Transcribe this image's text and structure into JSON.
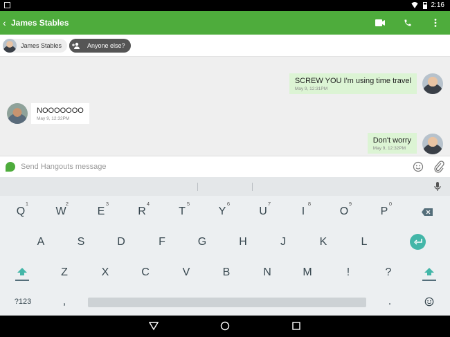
{
  "status": {
    "time": "2:16"
  },
  "app_bar": {
    "title": "James Stables",
    "icons": [
      "back-icon",
      "video-call-icon",
      "phone-icon",
      "more-icon"
    ]
  },
  "participants": {
    "chips": [
      {
        "label": "James Stables"
      },
      {
        "label": "Anyone else?"
      }
    ]
  },
  "messages": [
    {
      "direction": "out",
      "text": "SCREW YOU I'm using time travel",
      "time": "May 9, 12:31PM"
    },
    {
      "direction": "in",
      "text": "NOOOOOOO",
      "time": "May 9, 12:32PM"
    },
    {
      "direction": "out",
      "text": "Don't worry",
      "time": "May 9, 12:32PM"
    }
  ],
  "composer": {
    "placeholder": "Send Hangouts message"
  },
  "keyboard": {
    "row1": [
      {
        "label": "Q",
        "hint": "1"
      },
      {
        "label": "W",
        "hint": "2"
      },
      {
        "label": "E",
        "hint": "3"
      },
      {
        "label": "R",
        "hint": "4"
      },
      {
        "label": "T",
        "hint": "5"
      },
      {
        "label": "Y",
        "hint": "6"
      },
      {
        "label": "U",
        "hint": "7"
      },
      {
        "label": "I",
        "hint": "8"
      },
      {
        "label": "O",
        "hint": "9"
      },
      {
        "label": "P",
        "hint": "0"
      }
    ],
    "row2": [
      "A",
      "S",
      "D",
      "F",
      "G",
      "H",
      "J",
      "K",
      "L"
    ],
    "row3": [
      "Z",
      "X",
      "C",
      "V",
      "B",
      "N",
      "M",
      "!",
      "?"
    ],
    "symbols_label": "?123",
    "comma": ",",
    "period": "."
  },
  "colors": {
    "accent": "#4eac3c",
    "enter": "#43b6a8"
  }
}
